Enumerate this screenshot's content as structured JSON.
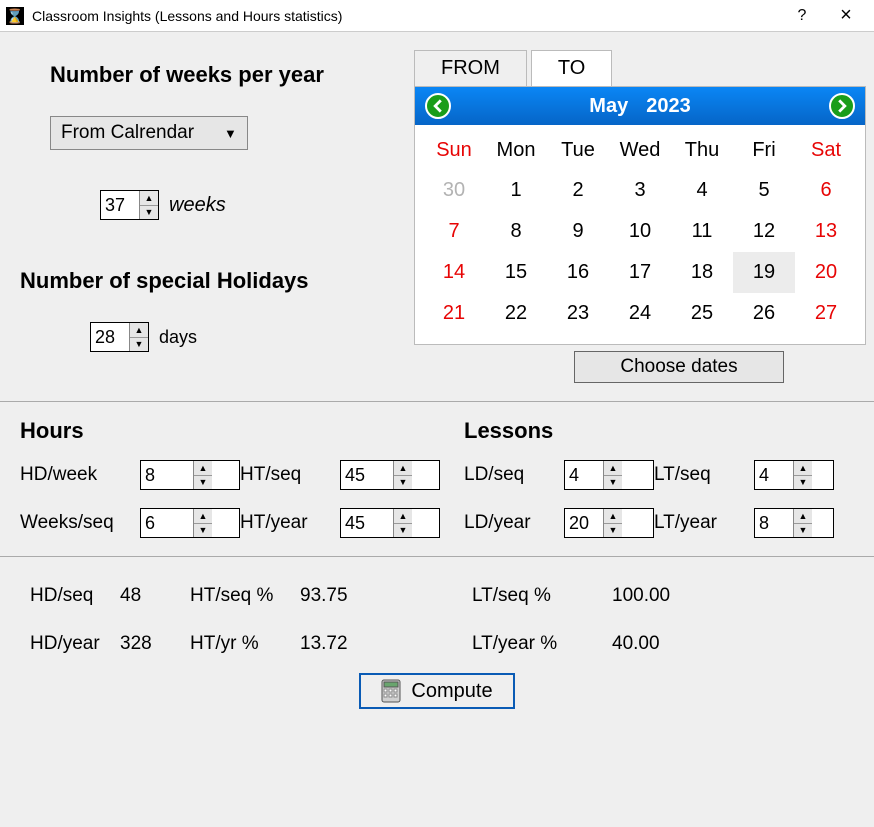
{
  "window": {
    "title": "Classroom Insights (Lessons and Hours statistics)",
    "help": "?",
    "close": "×"
  },
  "left": {
    "weeks_heading": "Number of weeks per year",
    "combo_selected": "From Calrendar",
    "weeks_value": "37",
    "weeks_unit": "weeks",
    "holidays_heading": "Number of special Holidays",
    "holidays_value": "28",
    "holidays_unit": "days"
  },
  "tabs": {
    "from": "FROM",
    "to": "TO"
  },
  "calendar": {
    "month": "May",
    "year": "2023",
    "dows": [
      "Sun",
      "Mon",
      "Tue",
      "Wed",
      "Thu",
      "Fri",
      "Sat"
    ],
    "cells": [
      {
        "t": "30",
        "cls": "muted"
      },
      {
        "t": "1"
      },
      {
        "t": "2"
      },
      {
        "t": "3"
      },
      {
        "t": "4"
      },
      {
        "t": "5"
      },
      {
        "t": "6",
        "cls": "red"
      },
      {
        "t": "7",
        "cls": "red"
      },
      {
        "t": "8"
      },
      {
        "t": "9"
      },
      {
        "t": "10"
      },
      {
        "t": "11"
      },
      {
        "t": "12"
      },
      {
        "t": "13",
        "cls": "red"
      },
      {
        "t": "14",
        "cls": "red"
      },
      {
        "t": "15"
      },
      {
        "t": "16"
      },
      {
        "t": "17"
      },
      {
        "t": "18"
      },
      {
        "t": "19",
        "cls": "today"
      },
      {
        "t": "20",
        "cls": "red"
      },
      {
        "t": "21",
        "cls": "red"
      },
      {
        "t": "22"
      },
      {
        "t": "23"
      },
      {
        "t": "24"
      },
      {
        "t": "25"
      },
      {
        "t": "26"
      },
      {
        "t": "27",
        "cls": "red"
      }
    ],
    "choose_dates": "Choose dates"
  },
  "sections": {
    "hours": "Hours",
    "lessons": "Lessons"
  },
  "hours": {
    "hd_week_label": "HD/week",
    "hd_week_value": "8",
    "ht_seq_label": "HT/seq",
    "ht_seq_value": "45",
    "weeks_seq_label": "Weeks/seq",
    "weeks_seq_value": "6",
    "ht_year_label": "HT/year",
    "ht_year_value": "45"
  },
  "lessons": {
    "ld_seq_label": "LD/seq",
    "ld_seq_value": "4",
    "lt_seq_label": "LT/seq",
    "lt_seq_value": "4",
    "ld_year_label": "LD/year",
    "ld_year_value": "20",
    "lt_year_label": "LT/year",
    "lt_year_value": "8"
  },
  "results": {
    "hd_seq_label": "HD/seq",
    "hd_seq_value": "48",
    "ht_seq_pct_label": "HT/seq %",
    "ht_seq_pct_value": "93.75",
    "hd_year_label": "HD/year",
    "hd_year_value": "328",
    "ht_yr_pct_label": "HT/yr %",
    "ht_yr_pct_value": "13.72",
    "lt_seq_pct_label": "LT/seq %",
    "lt_seq_pct_value": "100.00",
    "lt_year_pct_label": "LT/year %",
    "lt_year_pct_value": "40.00"
  },
  "compute_label": "Compute"
}
